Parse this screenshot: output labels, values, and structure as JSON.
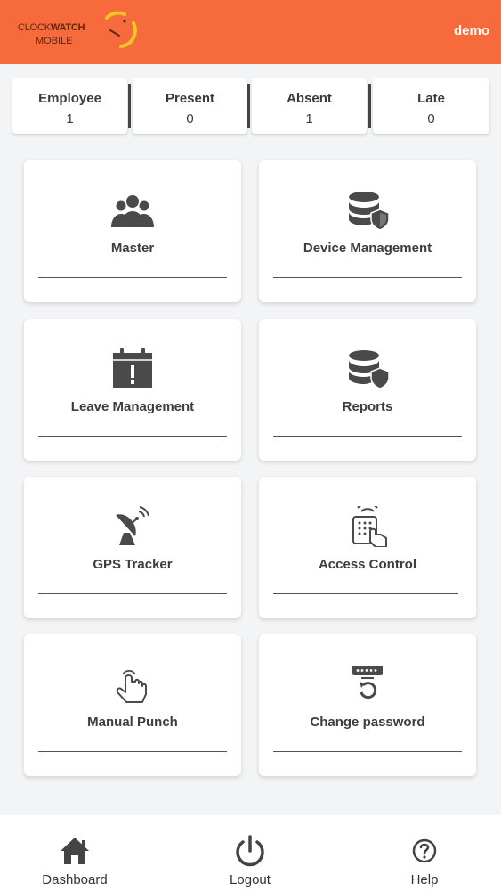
{
  "header": {
    "logo_line1_a": "CLOCK",
    "logo_line1_b": "WATCH",
    "logo_line2": "MOBILE",
    "user": "demo",
    "accent_color": "#f76a3b"
  },
  "stats": [
    {
      "label": "Employee",
      "value": "1"
    },
    {
      "label": "Present",
      "value": "0"
    },
    {
      "label": "Absent",
      "value": "1"
    },
    {
      "label": "Late",
      "value": "0"
    }
  ],
  "cards": [
    {
      "label": "Master",
      "icon": "users-group-icon"
    },
    {
      "label": "Device Management",
      "icon": "database-shield-icon"
    },
    {
      "label": "Leave Management",
      "icon": "calendar-alert-icon"
    },
    {
      "label": "Reports",
      "icon": "database-shield-icon"
    },
    {
      "label": "GPS Tracker",
      "icon": "satellite-dish-icon"
    },
    {
      "label": "Access Control",
      "icon": "keypad-touch-icon"
    },
    {
      "label": "Manual Punch",
      "icon": "hand-tap-icon"
    },
    {
      "label": "Change password",
      "icon": "password-reset-icon"
    }
  ],
  "bottom_nav": [
    {
      "label": "Dashboard",
      "icon": "home-icon"
    },
    {
      "label": "Logout",
      "icon": "power-icon"
    },
    {
      "label": "Help",
      "icon": "help-circle-icon"
    }
  ]
}
